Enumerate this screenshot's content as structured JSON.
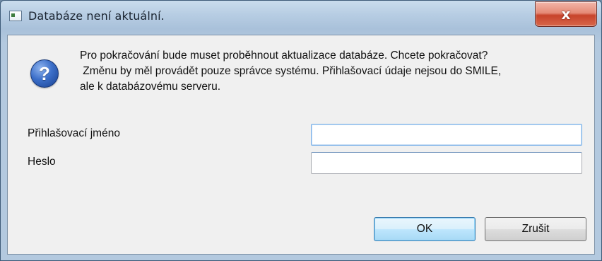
{
  "window": {
    "title": "Databáze není aktuální.",
    "close_glyph": "x"
  },
  "dialog": {
    "icon": "question-icon",
    "message_lines": [
      "Pro pokračování bude muset proběhnout aktualizace databáze. Chcete pokračovat?",
      " Změnu by měl provádět pouze správce systému. Přihlašovací údaje nejsou do SMILE,",
      "ale k databázovému serveru."
    ],
    "fields": {
      "login": {
        "label": "Přihlašovací jméno",
        "value": ""
      },
      "password": {
        "label": "Heslo",
        "value": ""
      }
    },
    "buttons": {
      "ok_label": "OK",
      "cancel_label": "Zrušit"
    }
  },
  "colors": {
    "frame": "#b7cde3",
    "client_bg": "#f0f0f0",
    "close_button": "#c7432b",
    "default_button": "#bee6fd"
  }
}
